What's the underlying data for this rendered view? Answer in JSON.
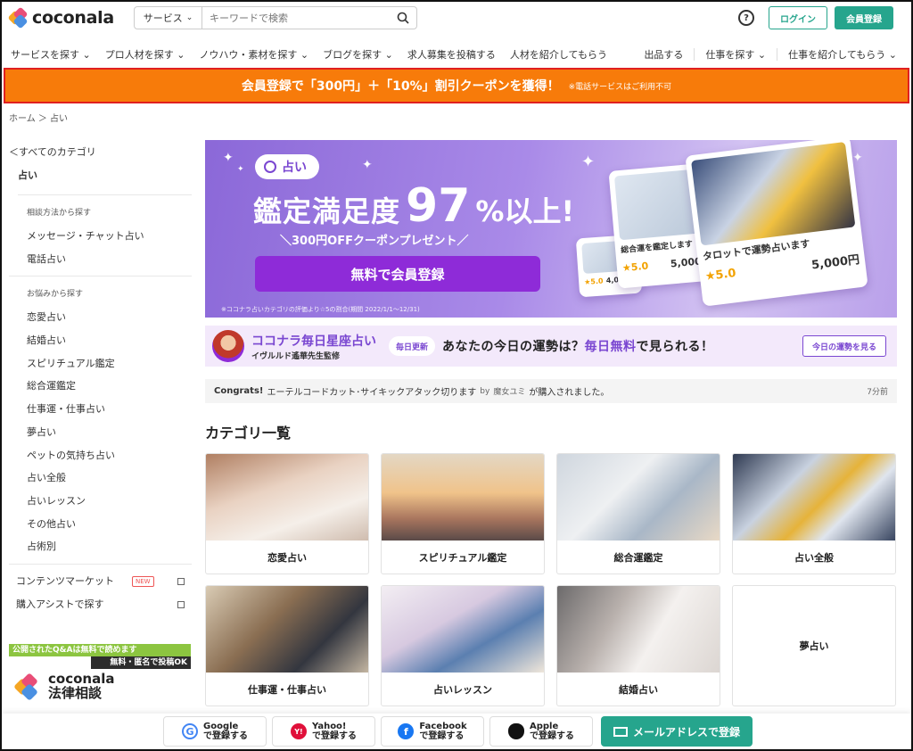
{
  "header": {
    "logo": "coconala",
    "search_category": "サービス",
    "search_placeholder": "キーワードで検索",
    "help": "?",
    "login": "ログイン",
    "register": "会員登録"
  },
  "nav": {
    "left": [
      "サービスを探す",
      "プロ人材を探す",
      "ノウハウ・素材を探す",
      "ブログを探す",
      "求人募集を投稿する",
      "人材を紹介してもらう"
    ],
    "right": [
      "出品する",
      "仕事を探す",
      "仕事を紹介してもらう"
    ]
  },
  "promo": {
    "main": "会員登録で「300円」＋「10%」割引クーポンを獲得！",
    "note": "※電話サービスはご利用不可"
  },
  "breadcrumb": "ホーム ＞ 占い",
  "sidebar": {
    "back": "＜すべてのカテゴリ",
    "current": "占い",
    "section1_heading": "相談方法から探す",
    "section1_items": [
      "メッセージ・チャット占い",
      "電話占い"
    ],
    "section2_heading": "お悩みから探す",
    "section2_items": [
      "恋愛占い",
      "結婚占い",
      "スピリチュアル鑑定",
      "総合運鑑定",
      "仕事運・仕事占い",
      "夢占い",
      "ペットの気持ち占い",
      "占い全般",
      "占いレッスン",
      "その他占い",
      "占術別"
    ],
    "link1": "コンテンツマーケット",
    "link1_badge": "NEW",
    "link2": "購入アシストで探す",
    "qa_top": "公開されたQ&Aは無料で読めます",
    "qa_mid": "無料・匿名で投稿OK",
    "qa_logo1": "coconala",
    "qa_logo2": "法律相談"
  },
  "hero": {
    "tag": "占い",
    "title_pre": "鑑定満足度",
    "title_num": "97",
    "title_post": "%以上!",
    "sub": "＼300円OFFクーポンプレゼント／",
    "cta": "無料で会員登録",
    "note": "※ココナラ占いカテゴリの評価より☆5の割合(期間 2022/1/1〜12/31)",
    "card1_label": "総合運を鑑定します",
    "card1_rating": "★5.0",
    "card1_price": "5,000円",
    "card2_label": "タロットで運勢占います",
    "card2_rating": "★5.0",
    "card2_price": "5,000円",
    "card0_rating": "★5.0",
    "card0_price": "4,000円"
  },
  "horoscope": {
    "title": "ココナラ毎日星座占い",
    "supervisor": "イヴルルド遙華先生監修",
    "pill": "毎日更新",
    "msg_pre": "あなたの今日の運勢は？",
    "msg_hl": "毎日無料",
    "msg_post": "で見られる！",
    "button": "今日の運勢を見る"
  },
  "congrats": {
    "label": "Congrats!",
    "service": "エーテルコードカット･サイキックアタック切ります",
    "by": "by",
    "user": "魔女ユミ",
    "suffix": "が購入されました。",
    "time": "7分前"
  },
  "categories": {
    "title": "カテゴリ一覧",
    "items": [
      "恋愛占い",
      "スピリチュアル鑑定",
      "総合運鑑定",
      "占い全般",
      "仕事運・仕事占い",
      "占いレッスン",
      "結婚占い",
      "夢占い"
    ]
  },
  "bottom": {
    "google_1": "Google",
    "google_2": "で登録する",
    "yahoo_1": "Yahoo!",
    "yahoo_2": "で登録する",
    "facebook_1": "Facebook",
    "facebook_2": "で登録する",
    "apple_1": "Apple",
    "apple_2": "で登録する",
    "mail": "メールアドレスで登録"
  },
  "colors": {
    "brand": "#26a58d",
    "promo": "#f77b0a",
    "purple": "#7a47d1"
  }
}
